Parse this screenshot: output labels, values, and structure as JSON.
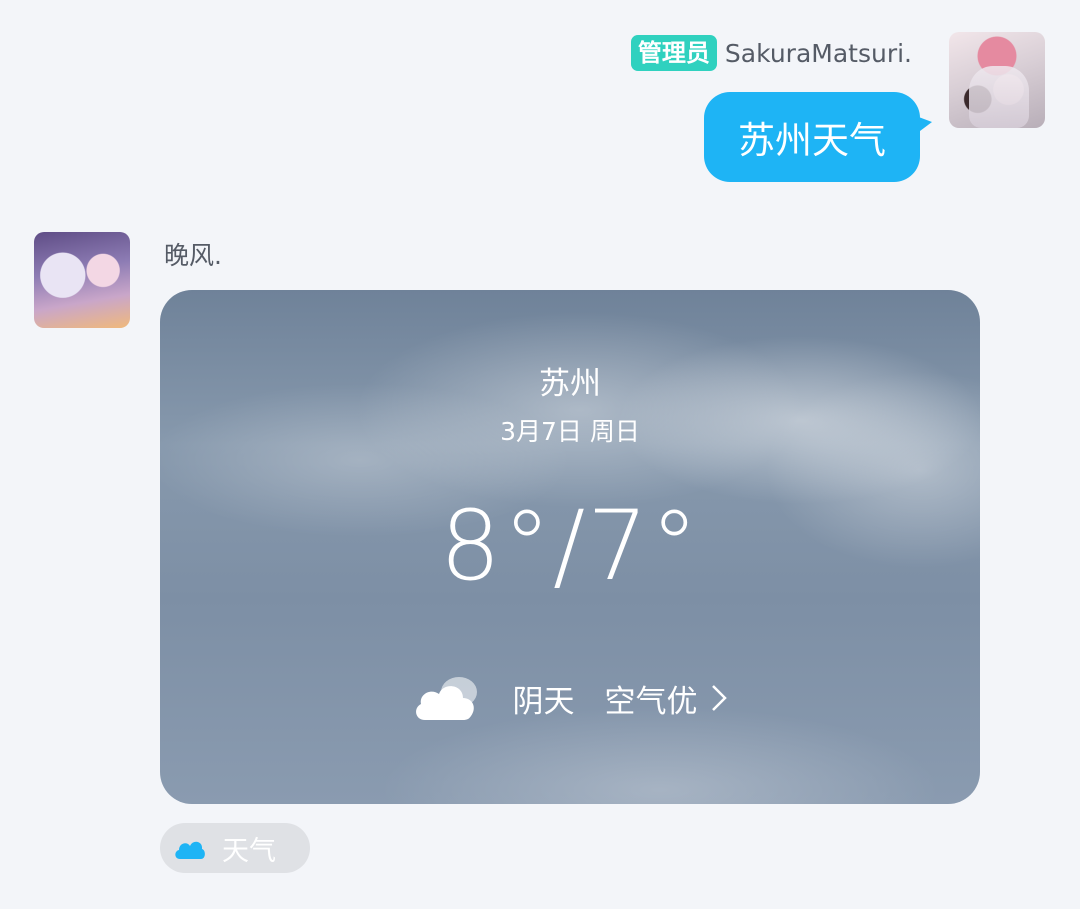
{
  "outgoing": {
    "role_badge": "管理员",
    "sender_name": "SakuraMatsuri.",
    "message": "苏州天气"
  },
  "incoming": {
    "sender_name": "晚风.",
    "weather_card": {
      "city": "苏州",
      "date": "3月7日 周日",
      "temperature": "8°/7°",
      "condition": "阴天",
      "condition_icon": "cloud-icon",
      "air_quality": "空气优"
    }
  },
  "quick_reply": {
    "label": "天气",
    "icon": "cloud-icon"
  },
  "colors": {
    "background": "#f3f5f9",
    "outgoing_bubble": "#1eb4f5",
    "role_badge": "#2fd1bf",
    "chip_background": "#dfe1e5",
    "chip_icon": "#1eb4f5"
  }
}
